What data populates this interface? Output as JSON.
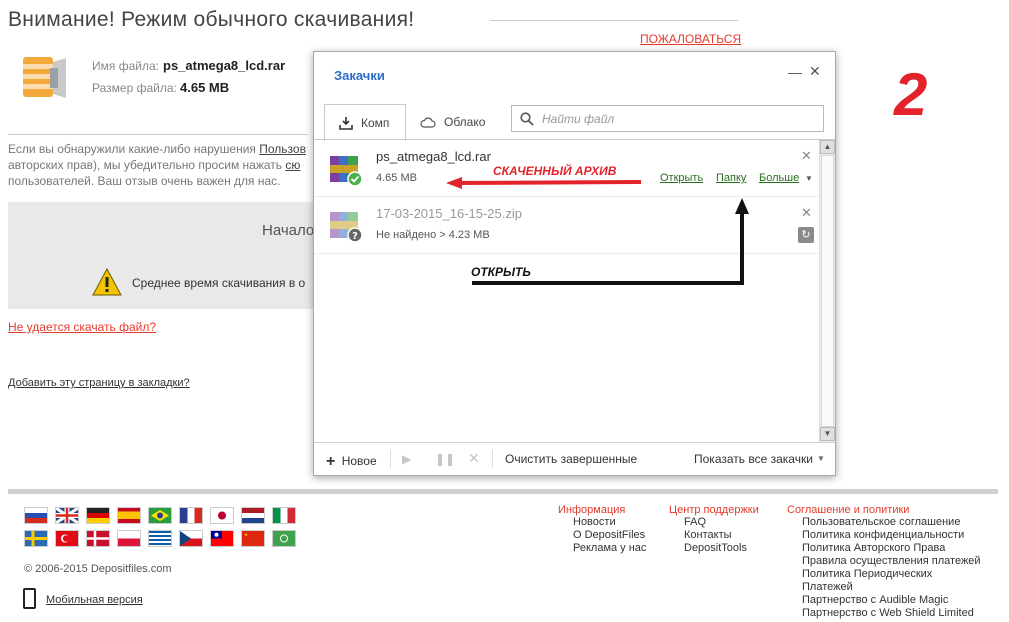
{
  "page": {
    "title": "Внимание! Режим обычного скачивания!",
    "report_link": "ПОЖАЛОВАТЬСЯ",
    "file_name_label": "Имя файла:",
    "file_name": "ps_atmega8_lcd.rar",
    "file_size_label": "Размер файла:",
    "file_size": "4.65 MB",
    "notice_line1_text": "Если вы обнаружили какие-либо нарушения ",
    "notice_line1_link": "Пользов",
    "notice_line2_text": "авторских прав), мы убедительно просим нажать ",
    "notice_line2_link": "сю",
    "notice_line3": "пользователей. Ваш отзыв очень важен для нас.",
    "start_text": "Начало",
    "avg_time_text": "Среднее время скачивания в о",
    "cant_download_link": "Не удается скачать файл?",
    "bookmark_link": "Добавить эту страницу в закладки?",
    "step_number": "2"
  },
  "footer": {
    "copyright": "© 2006-2015 Depositfiles.com",
    "mobile_link": "Мобильная версия",
    "col1": {
      "heading": "Информация",
      "items": [
        "Новости",
        "О DepositFiles",
        "Реклама у нас"
      ]
    },
    "col2": {
      "heading": "Центр поддержки",
      "items": [
        "FAQ",
        "Контакты",
        "DepositTools"
      ]
    },
    "col3": {
      "heading": "Соглашение и политики",
      "items": [
        "Пользовательское соглашение",
        "Политика конфиденциальности",
        "Политика Авторского Права",
        "Правила осуществления платежей",
        "Политика Периодических",
        "Платежей",
        "Партнерство с Audible Magic",
        "Партнерство с Web Shield Limited"
      ]
    }
  },
  "popup": {
    "title": "Закачки",
    "tab_local": "Комп",
    "tab_cloud": "Облако",
    "search_placeholder": "Найти файл",
    "items": [
      {
        "name": "ps_atmega8_lcd.rar",
        "sub": "4.65 MB",
        "action_open": "Открыть",
        "action_folder": "Папку",
        "action_more": "Больше"
      },
      {
        "name": "17-03-2015_16-15-25.zip",
        "sub": "Не найдено > 4.23 MB"
      }
    ],
    "new_label": "Новое",
    "clear_label": "Очистить завершенные",
    "show_all_label": "Показать все закачки"
  },
  "annotations": {
    "downloaded_archive": "СКАЧЕННЫЙ АРХИВ",
    "open": "ОТКРЫТЬ"
  },
  "colors": {
    "accent_red": "#e3232b",
    "link_red": "#e53b2c",
    "popup_title_blue": "#2d6cc8",
    "action_green": "#2a6e1f"
  }
}
